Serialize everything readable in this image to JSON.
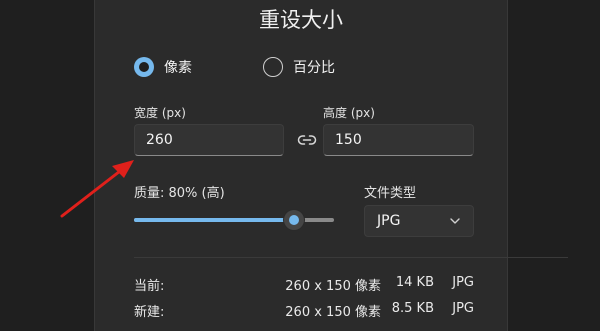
{
  "dialog": {
    "title": "重设大小"
  },
  "mode": {
    "option_pixels": "像素",
    "option_percent": "百分比",
    "selected": "像素"
  },
  "width": {
    "label": "宽度 (px)",
    "value": "260"
  },
  "height": {
    "label": "高度 (px)",
    "value": "150"
  },
  "quality": {
    "label": "质量: 80% (高)",
    "level_percent": 80
  },
  "file_type": {
    "label": "文件类型",
    "selected": "JPG"
  },
  "summary": {
    "current": {
      "label": "当前:",
      "dimensions": "260 x 150 像素",
      "size": "14 KB",
      "format": "JPG"
    },
    "new": {
      "label": "新建:",
      "dimensions": "260 x 150 像素",
      "size": "8.5 KB",
      "format": "JPG"
    }
  },
  "icons": {
    "link": "link-icon",
    "chevron": "chevron-down-icon",
    "annotation": "red-arrow-annotation"
  },
  "colors": {
    "accent": "#76b9ed",
    "arrow": "#e0201b",
    "dialog_bg": "#2b2b2b"
  }
}
